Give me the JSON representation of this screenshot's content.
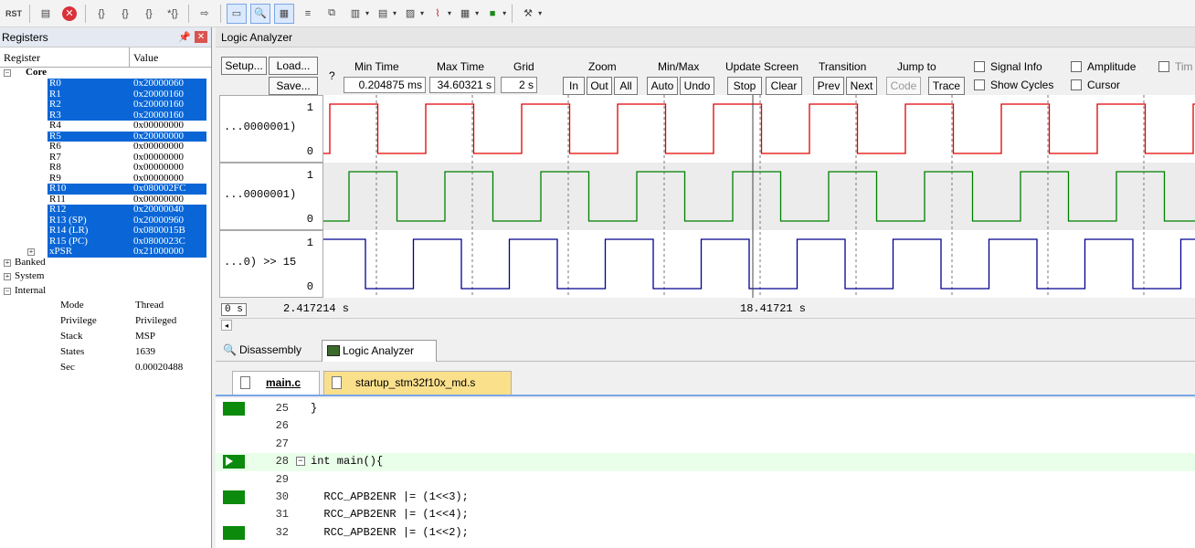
{
  "toolbar": {
    "rst_label": "RST",
    "items": [
      "reset-icon",
      "view-icon",
      "stop-icon",
      "step-into-icon",
      "step-over-icon",
      "step-out-icon",
      "run-to-cursor-icon",
      "show-next-icon",
      "command-window-icon",
      "disassembly-window-icon",
      "symbols-window-icon",
      "registers-window-icon",
      "call-stack-icon",
      "watch-window-icon",
      "memory-window-icon",
      "serial-window-icon",
      "analysis-window-icon",
      "trace-window-icon",
      "system-viewer-icon",
      "toolbox-icon"
    ]
  },
  "registers": {
    "title": "Registers",
    "col_register": "Register",
    "col_value": "Value",
    "core_label": "Core",
    "rows": [
      {
        "name": "R0",
        "value": "0x20000060",
        "hl": true
      },
      {
        "name": "R1",
        "value": "0x20000160",
        "hl": true
      },
      {
        "name": "R2",
        "value": "0x20000160",
        "hl": true
      },
      {
        "name": "R3",
        "value": "0x20000160",
        "hl": true
      },
      {
        "name": "R4",
        "value": "0x00000000",
        "hl": false
      },
      {
        "name": "R5",
        "value": "0x20000000",
        "hl": true
      },
      {
        "name": "R6",
        "value": "0x00000000",
        "hl": false
      },
      {
        "name": "R7",
        "value": "0x00000000",
        "hl": false
      },
      {
        "name": "R8",
        "value": "0x00000000",
        "hl": false
      },
      {
        "name": "R9",
        "value": "0x00000000",
        "hl": false
      },
      {
        "name": "R10",
        "value": "0x080002FC",
        "hl": true
      },
      {
        "name": "R11",
        "value": "0x00000000",
        "hl": false
      },
      {
        "name": "R12",
        "value": "0x20000040",
        "hl": true
      },
      {
        "name": "R13 (SP)",
        "value": "0x20000960",
        "hl": true
      },
      {
        "name": "R14 (LR)",
        "value": "0x0800015B",
        "hl": true
      },
      {
        "name": "R15 (PC)",
        "value": "0x0800023C",
        "hl": true
      },
      {
        "name": "xPSR",
        "value": "0x21000000",
        "hl": true
      }
    ],
    "banked_label": "Banked",
    "system_label": "System",
    "internal_label": "Internal",
    "internal": [
      {
        "name": "Mode",
        "value": "Thread"
      },
      {
        "name": "Privilege",
        "value": "Privileged"
      },
      {
        "name": "Stack",
        "value": "MSP"
      },
      {
        "name": "States",
        "value": "1639"
      },
      {
        "name": "Sec",
        "value": "0.00020488"
      }
    ]
  },
  "logic_analyzer": {
    "title": "Logic Analyzer",
    "setup": "Setup...",
    "load": "Load...",
    "save": "Save...",
    "help": "?",
    "min_time_label": "Min Time",
    "min_time": "0.204875 ms",
    "max_time_label": "Max Time",
    "max_time": "34.60321 s",
    "grid_label": "Grid",
    "grid": "2 s",
    "zoom_label": "Zoom",
    "zoom_in": "In",
    "zoom_out": "Out",
    "zoom_all": "All",
    "minmax_label": "Min/Max",
    "auto": "Auto",
    "undo": "Undo",
    "update_label": "Update Screen",
    "stop": "Stop",
    "clear": "Clear",
    "transition_label": "Transition",
    "prev": "Prev",
    "next": "Next",
    "jump_label": "Jump to",
    "code": "Code",
    "trace": "Trace",
    "signal_info": "Signal Info",
    "show_cycles": "Show Cycles",
    "amplitude": "Amplitude",
    "cursor": "Cursor",
    "timestamps": "Tim",
    "signals": [
      {
        "name": "...0000001)",
        "one": "1",
        "zero": "0",
        "color": "#e00000"
      },
      {
        "name": "...0000001)",
        "one": "1",
        "zero": "0",
        "color": "#008000"
      },
      {
        "name": "...0) >> 15",
        "one": "1",
        "zero": "0",
        "color": "#000090"
      }
    ],
    "time_origin": "0 s",
    "time_left": "2.417214 s",
    "time_right": "18.41721 s"
  },
  "bottom_tabs": {
    "disassembly": "Disassembly",
    "logic_analyzer": "Logic Analyzer"
  },
  "file_tabs": {
    "main": "main.c",
    "startup": "startup_stm32f10x_md.s"
  },
  "code": [
    {
      "ln": "25",
      "text": "}",
      "gut": true,
      "cur": false
    },
    {
      "ln": "26",
      "text": "",
      "gut": false,
      "cur": false
    },
    {
      "ln": "27",
      "text": "",
      "gut": false,
      "cur": false
    },
    {
      "ln": "28",
      "text": "int main(){",
      "gut": true,
      "cur": true
    },
    {
      "ln": "29",
      "text": "",
      "gut": false,
      "cur": false
    },
    {
      "ln": "30",
      "text": "  RCC_APB2ENR |= (1<<3);",
      "gut": true,
      "cur": false
    },
    {
      "ln": "31",
      "text": "  RCC_APB2ENR |= (1<<4);",
      "gut": false,
      "cur": false
    },
    {
      "ln": "32",
      "text": "  RCC_APB2ENR |= (1<<2);",
      "gut": true,
      "cur": false
    }
  ]
}
